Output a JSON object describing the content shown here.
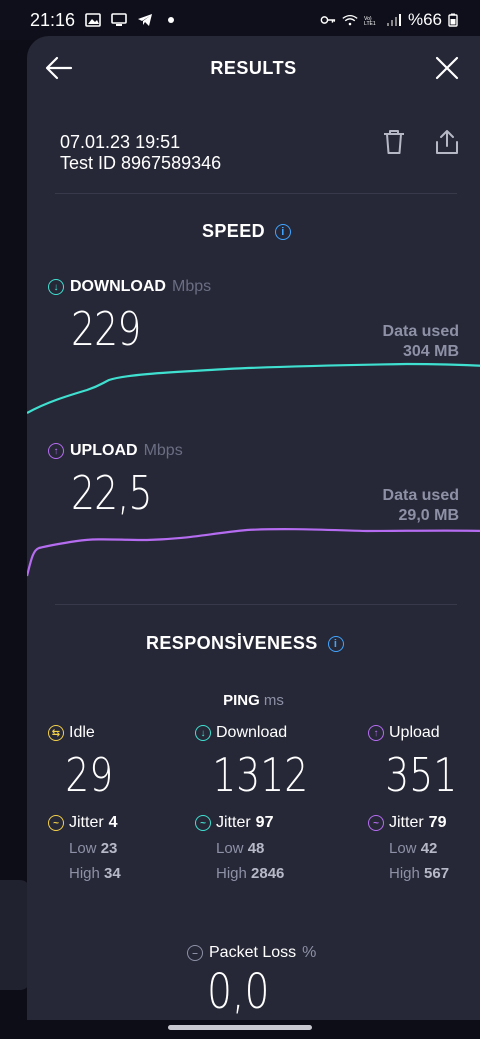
{
  "status_bar": {
    "time": "21:16",
    "battery": "%66"
  },
  "header": {
    "title": "RESULTS"
  },
  "result": {
    "datetime": "07.01.23 19:51",
    "test_id": "Test ID 8967589346"
  },
  "speed": {
    "title": "SPEED",
    "download": {
      "label": "DOWNLOAD",
      "unit": "Mbps",
      "value": "229",
      "data_used_label": "Data used",
      "data_used_value": "304 MB",
      "color": "#3fe0d0"
    },
    "upload": {
      "label": "UPLOAD",
      "unit": "Mbps",
      "value": "22,5",
      "data_used_label": "Data used",
      "data_used_value": "29,0 MB",
      "color": "#b56cf0"
    }
  },
  "responsiveness": {
    "title": "RESPONSİVENESS",
    "ping_label": "PING",
    "ping_unit": "ms",
    "idle": {
      "label": "Idle",
      "value": "29",
      "jitter_label": "Jitter",
      "jitter": "4",
      "low_label": "Low",
      "low": "23",
      "high_label": "High",
      "high": "34",
      "color": "#f2d04a"
    },
    "download": {
      "label": "Download",
      "value": "1312",
      "jitter_label": "Jitter",
      "jitter": "97",
      "low_label": "Low",
      "low": "48",
      "high_label": "High",
      "high": "2846",
      "color": "#3fe0d0"
    },
    "upload": {
      "label": "Upload",
      "value": "351",
      "jitter_label": "Jitter",
      "jitter": "79",
      "low_label": "Low",
      "low": "42",
      "high_label": "High",
      "high": "567",
      "color": "#b56cf0"
    }
  },
  "packet_loss": {
    "label": "Packet Loss",
    "unit": "%",
    "value": "0,0"
  },
  "icons": [
    "back-arrow-icon",
    "close-icon",
    "trash-icon",
    "share-icon",
    "info-icon",
    "download-arrow-icon",
    "upload-arrow-icon",
    "idle-icon",
    "jitter-icon",
    "packet-loss-icon"
  ]
}
